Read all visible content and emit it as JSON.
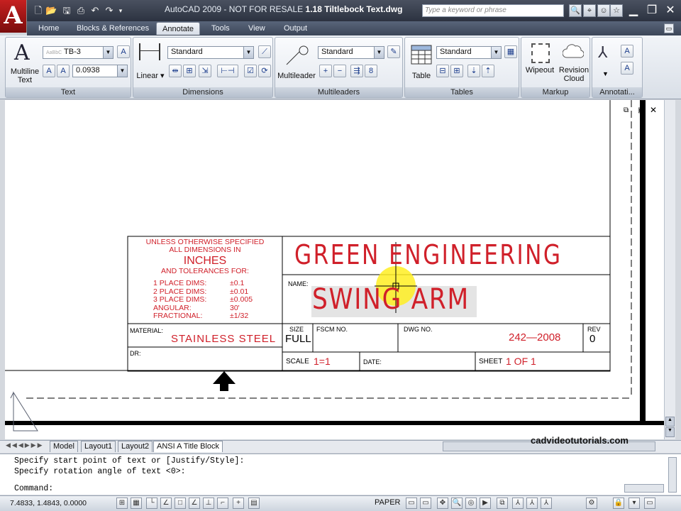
{
  "app": {
    "logo": "A",
    "title_prefix": "AutoCAD 2009 - NOT FOR RESALE",
    "title_file": "1.18 Tiltlebock Text.dwg",
    "search_placeholder": "Type a keyword or phrase",
    "accent": "#c62020"
  },
  "tabs": [
    "Home",
    "Blocks & References",
    "Annotate",
    "Tools",
    "View",
    "Output"
  ],
  "active_tab": "Annotate",
  "ribbon": {
    "text": {
      "label": "Text",
      "big_label_1": "Multiline",
      "big_label_2": "Text",
      "style": "TB-3",
      "height": "0.0938"
    },
    "dimensions": {
      "label": "Dimensions",
      "linear": "Linear",
      "style": "Standard"
    },
    "multileaders": {
      "label": "Multileaders",
      "big_label": "Multileader",
      "style": "Standard"
    },
    "tables": {
      "label": "Tables",
      "big_label": "Table",
      "style": "Standard"
    },
    "markup": {
      "label": "Markup",
      "wipeout": "Wipeout",
      "revision_1": "Revision",
      "revision_2": "Cloud"
    },
    "annotation": {
      "label": "Annotati..."
    }
  },
  "titleblock": {
    "tolerance_lines": [
      "UNLESS OTHERWISE SPECIFIED",
      "ALL DIMENSIONS IN"
    ],
    "units": "INCHES",
    "tolerance_for": "AND TOLERANCES FOR:",
    "tolerances": [
      {
        "name": "1  PLACE  DIMS:",
        "value": "±0.1"
      },
      {
        "name": "2  PLACE  DIMS:",
        "value": "±0.01"
      },
      {
        "name": "3  PLACE  DIMS:",
        "value": "±0.005"
      },
      {
        "name": "ANGULAR:",
        "value": "30'"
      },
      {
        "name": "FRACTIONAL:",
        "value": "±1/32"
      }
    ],
    "company": "GREEN  ENGINEERING",
    "name_label": "NAME:",
    "part_name": "SWING  ARM",
    "material_label": "MATERIAL:",
    "material": "STAINLESS  STEEL",
    "dr_label": "DR:",
    "size_label": "SIZE",
    "size": "FULL",
    "fscm_label": "FSCM  NO.",
    "dwg_label": "DWG  NO.",
    "dwg_no": "242—2008",
    "rev_label": "REV",
    "rev": "0",
    "scale_label": "SCALE",
    "scale": "1=1",
    "date_label": "DATE:",
    "sheet_label": "SHEET",
    "sheet": "1  OF  1"
  },
  "layout_tabs": [
    "Model",
    "Layout1",
    "Layout2",
    "ANSI A Title Block"
  ],
  "active_layout": "ANSI A Title Block",
  "watermark": "cadvideotutorials.com",
  "command_lines": [
    "Specify start point of text or [Justify/Style]:",
    "Specify rotation angle of text <0>:"
  ],
  "command_prompt": "Command:",
  "status": {
    "coords": "7.4833, 1.4843, 0.0000",
    "space": "PAPER"
  }
}
